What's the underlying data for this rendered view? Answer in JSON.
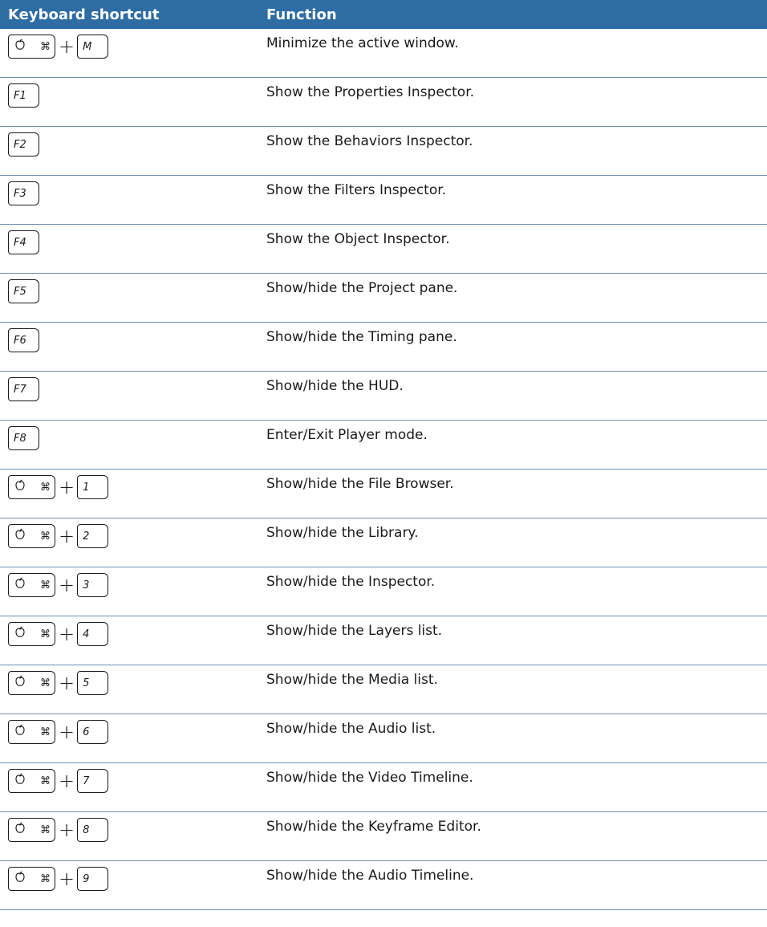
{
  "header": {
    "col1": "Keyboard shortcut",
    "col2": "Function"
  },
  "modifier_symbols": {
    "apple": "͡",
    "command": "⌘"
  },
  "rows": [
    {
      "keys": [
        "cmd",
        "M"
      ],
      "function": "Minimize the active window."
    },
    {
      "keys": [
        "F1"
      ],
      "function": "Show the Properties Inspector."
    },
    {
      "keys": [
        "F2"
      ],
      "function": "Show the Behaviors Inspector."
    },
    {
      "keys": [
        "F3"
      ],
      "function": "Show the Filters Inspector."
    },
    {
      "keys": [
        "F4"
      ],
      "function": "Show the Object Inspector."
    },
    {
      "keys": [
        "F5"
      ],
      "function": "Show/hide the Project pane."
    },
    {
      "keys": [
        "F6"
      ],
      "function": "Show/hide the Timing pane."
    },
    {
      "keys": [
        "F7"
      ],
      "function": "Show/hide the HUD."
    },
    {
      "keys": [
        "F8"
      ],
      "function": "Enter/Exit Player mode."
    },
    {
      "keys": [
        "cmd",
        "1"
      ],
      "function": "Show/hide the File Browser."
    },
    {
      "keys": [
        "cmd",
        "2"
      ],
      "function": "Show/hide the Library."
    },
    {
      "keys": [
        "cmd",
        "3"
      ],
      "function": "Show/hide the Inspector."
    },
    {
      "keys": [
        "cmd",
        "4"
      ],
      "function": "Show/hide the Layers list."
    },
    {
      "keys": [
        "cmd",
        "5"
      ],
      "function": "Show/hide the Media list."
    },
    {
      "keys": [
        "cmd",
        "6"
      ],
      "function": "Show/hide the Audio list."
    },
    {
      "keys": [
        "cmd",
        "7"
      ],
      "function": "Show/hide the Video Timeline."
    },
    {
      "keys": [
        "cmd",
        "8"
      ],
      "function": "Show/hide the Keyframe Editor."
    },
    {
      "keys": [
        "cmd",
        "9"
      ],
      "function": "Show/hide the Audio Timeline."
    }
  ]
}
